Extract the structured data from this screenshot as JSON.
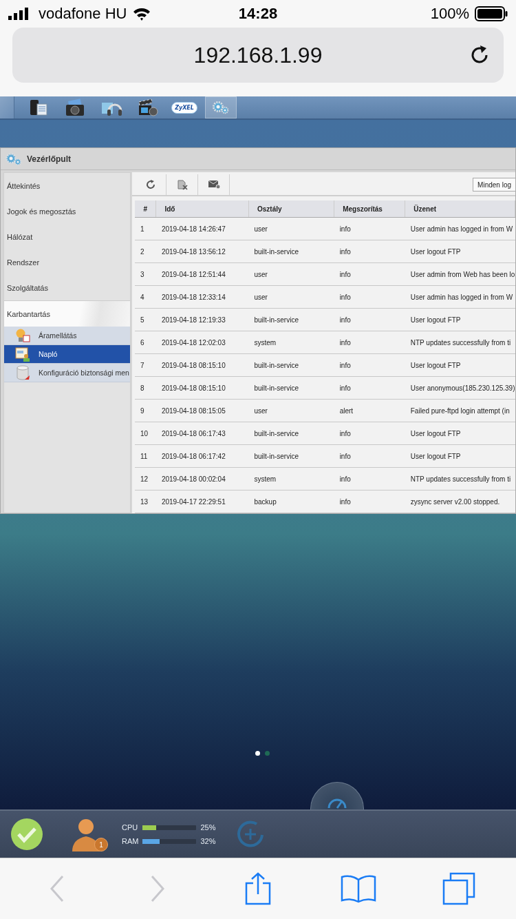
{
  "status_bar": {
    "carrier": "vodafone HU",
    "time": "14:28",
    "battery": "100%"
  },
  "address_bar": {
    "url": "192.168.1.99"
  },
  "taskbar": {
    "apps": [
      {
        "kind": "storage",
        "selected": false
      },
      {
        "kind": "photo",
        "selected": false
      },
      {
        "kind": "music",
        "selected": false
      },
      {
        "kind": "video",
        "selected": false
      },
      {
        "kind": "cloud",
        "label": "ZyXEL",
        "selected": false
      },
      {
        "kind": "settings",
        "selected": true
      }
    ]
  },
  "window": {
    "title": "Vezérlőpult",
    "sidebar": {
      "items": [
        {
          "label": "Áttekintés",
          "expanded": false
        },
        {
          "label": "Jogok és megosztás",
          "expanded": false
        },
        {
          "label": "Hálózat",
          "expanded": false
        },
        {
          "label": "Rendszer",
          "expanded": false
        },
        {
          "label": "Szolgáltatás",
          "expanded": false
        },
        {
          "label": "Karbantartás",
          "expanded": true,
          "children": [
            {
              "label": "Áramellátás",
              "kind": "power",
              "selected": false
            },
            {
              "label": "Napló",
              "kind": "log",
              "selected": true
            },
            {
              "label": "Konfiguráció biztonsági men",
              "kind": "backup",
              "selected": false
            }
          ]
        }
      ]
    },
    "toolbar": {
      "buttons": [
        {
          "kind": "refresh"
        },
        {
          "kind": "clear"
        },
        {
          "kind": "mail"
        }
      ],
      "filter": {
        "value": "Minden log"
      }
    },
    "table": {
      "columns": [
        "#",
        "Idő",
        "Osztály",
        "Megszorítás",
        "Üzenet"
      ],
      "rows": [
        [
          "1",
          "2019-04-18 14:26:47",
          "user",
          "info",
          "User admin has logged in from W"
        ],
        [
          "2",
          "2019-04-18 13:56:12",
          "built-in-service",
          "info",
          "User logout FTP"
        ],
        [
          "3",
          "2019-04-18 12:51:44",
          "user",
          "info",
          "User admin from Web has been lo"
        ],
        [
          "4",
          "2019-04-18 12:33:14",
          "user",
          "info",
          "User admin has logged in from W"
        ],
        [
          "5",
          "2019-04-18 12:19:33",
          "built-in-service",
          "info",
          "User logout FTP"
        ],
        [
          "6",
          "2019-04-18 12:02:03",
          "system",
          "info",
          "NTP updates successfully from ti"
        ],
        [
          "7",
          "2019-04-18 08:15:10",
          "built-in-service",
          "info",
          "User logout FTP"
        ],
        [
          "8",
          "2019-04-18 08:15:10",
          "built-in-service",
          "info",
          "User anonymous(185.230.125.39)"
        ],
        [
          "9",
          "2019-04-18 08:15:05",
          "user",
          "alert",
          "Failed pure-ftpd login attempt (in"
        ],
        [
          "10",
          "2019-04-18 06:17:43",
          "built-in-service",
          "info",
          "User logout FTP"
        ],
        [
          "11",
          "2019-04-18 06:17:42",
          "built-in-service",
          "info",
          "User logout FTP"
        ],
        [
          "12",
          "2019-04-18 00:02:04",
          "system",
          "info",
          "NTP updates successfully from ti"
        ],
        [
          "13",
          "2019-04-17 22:29:51",
          "backup",
          "info",
          "zysync server v2.00 stopped."
        ]
      ]
    }
  },
  "page_dots": [
    {
      "selected": true
    },
    {
      "selected": false
    }
  ],
  "dock": {
    "status": {
      "kind": "ok"
    },
    "user": {
      "badge": "1"
    },
    "meters": [
      {
        "label": "CPU",
        "level": 0.25,
        "reading": "25%",
        "color": "#9ccc50"
      },
      {
        "label": "RAM",
        "level": 0.32,
        "reading": "32%",
        "color": "#5aa6e6"
      }
    ]
  },
  "browser_toolbar": {
    "buttons": [
      {
        "kind": "back",
        "disabled": true
      },
      {
        "kind": "forward",
        "disabled": true
      },
      {
        "kind": "share",
        "disabled": false
      },
      {
        "kind": "bookmarks",
        "disabled": false
      },
      {
        "kind": "tabs",
        "disabled": false
      }
    ]
  }
}
